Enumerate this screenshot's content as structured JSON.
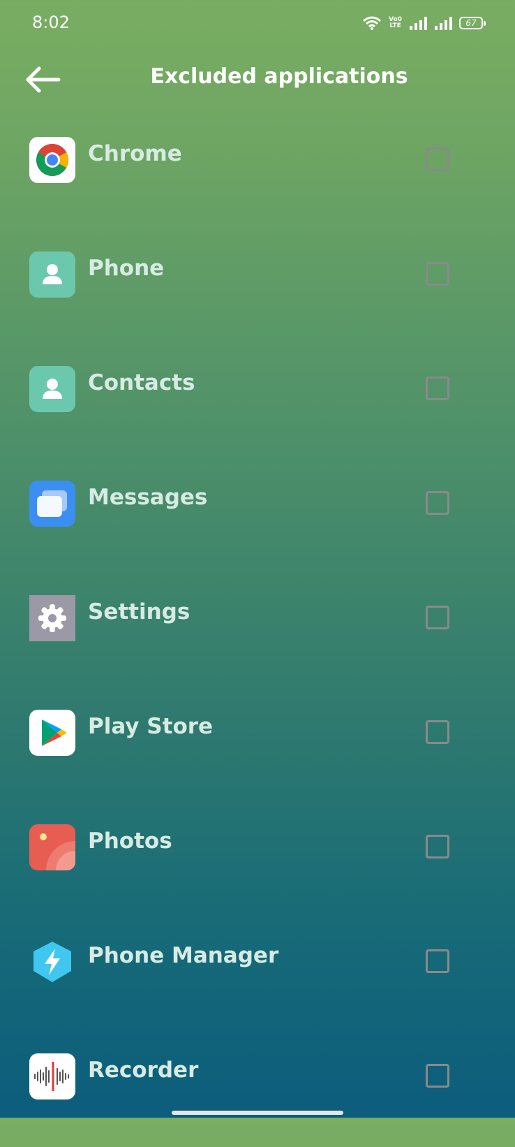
{
  "status_bar": {
    "time": "8:02",
    "network_label_top": "Vo0",
    "network_label_bottom": "LTE",
    "battery": "67"
  },
  "header": {
    "title": "Excluded applications",
    "back_icon": "arrow-left-icon"
  },
  "apps": [
    {
      "label": "Chrome",
      "icon": "chrome-icon",
      "checked": false
    },
    {
      "label": "Phone",
      "icon": "phone-app-icon",
      "checked": false
    },
    {
      "label": "Contacts",
      "icon": "contacts-app-icon",
      "checked": false
    },
    {
      "label": "Messages",
      "icon": "messages-app-icon",
      "checked": false
    },
    {
      "label": "Settings",
      "icon": "settings-app-icon",
      "checked": false
    },
    {
      "label": "Play Store",
      "icon": "play-store-icon",
      "checked": false
    },
    {
      "label": "Photos",
      "icon": "photos-app-icon",
      "checked": false
    },
    {
      "label": "Phone Manager",
      "icon": "phone-manager-icon",
      "checked": false
    },
    {
      "label": "Recorder",
      "icon": "recorder-app-icon",
      "checked": false
    }
  ],
  "colors": {
    "background_top": "#79ad62",
    "background_bottom": "#0b5d7c",
    "label": "#d7ebe3",
    "checkbox_border": "#8a8a8a"
  }
}
